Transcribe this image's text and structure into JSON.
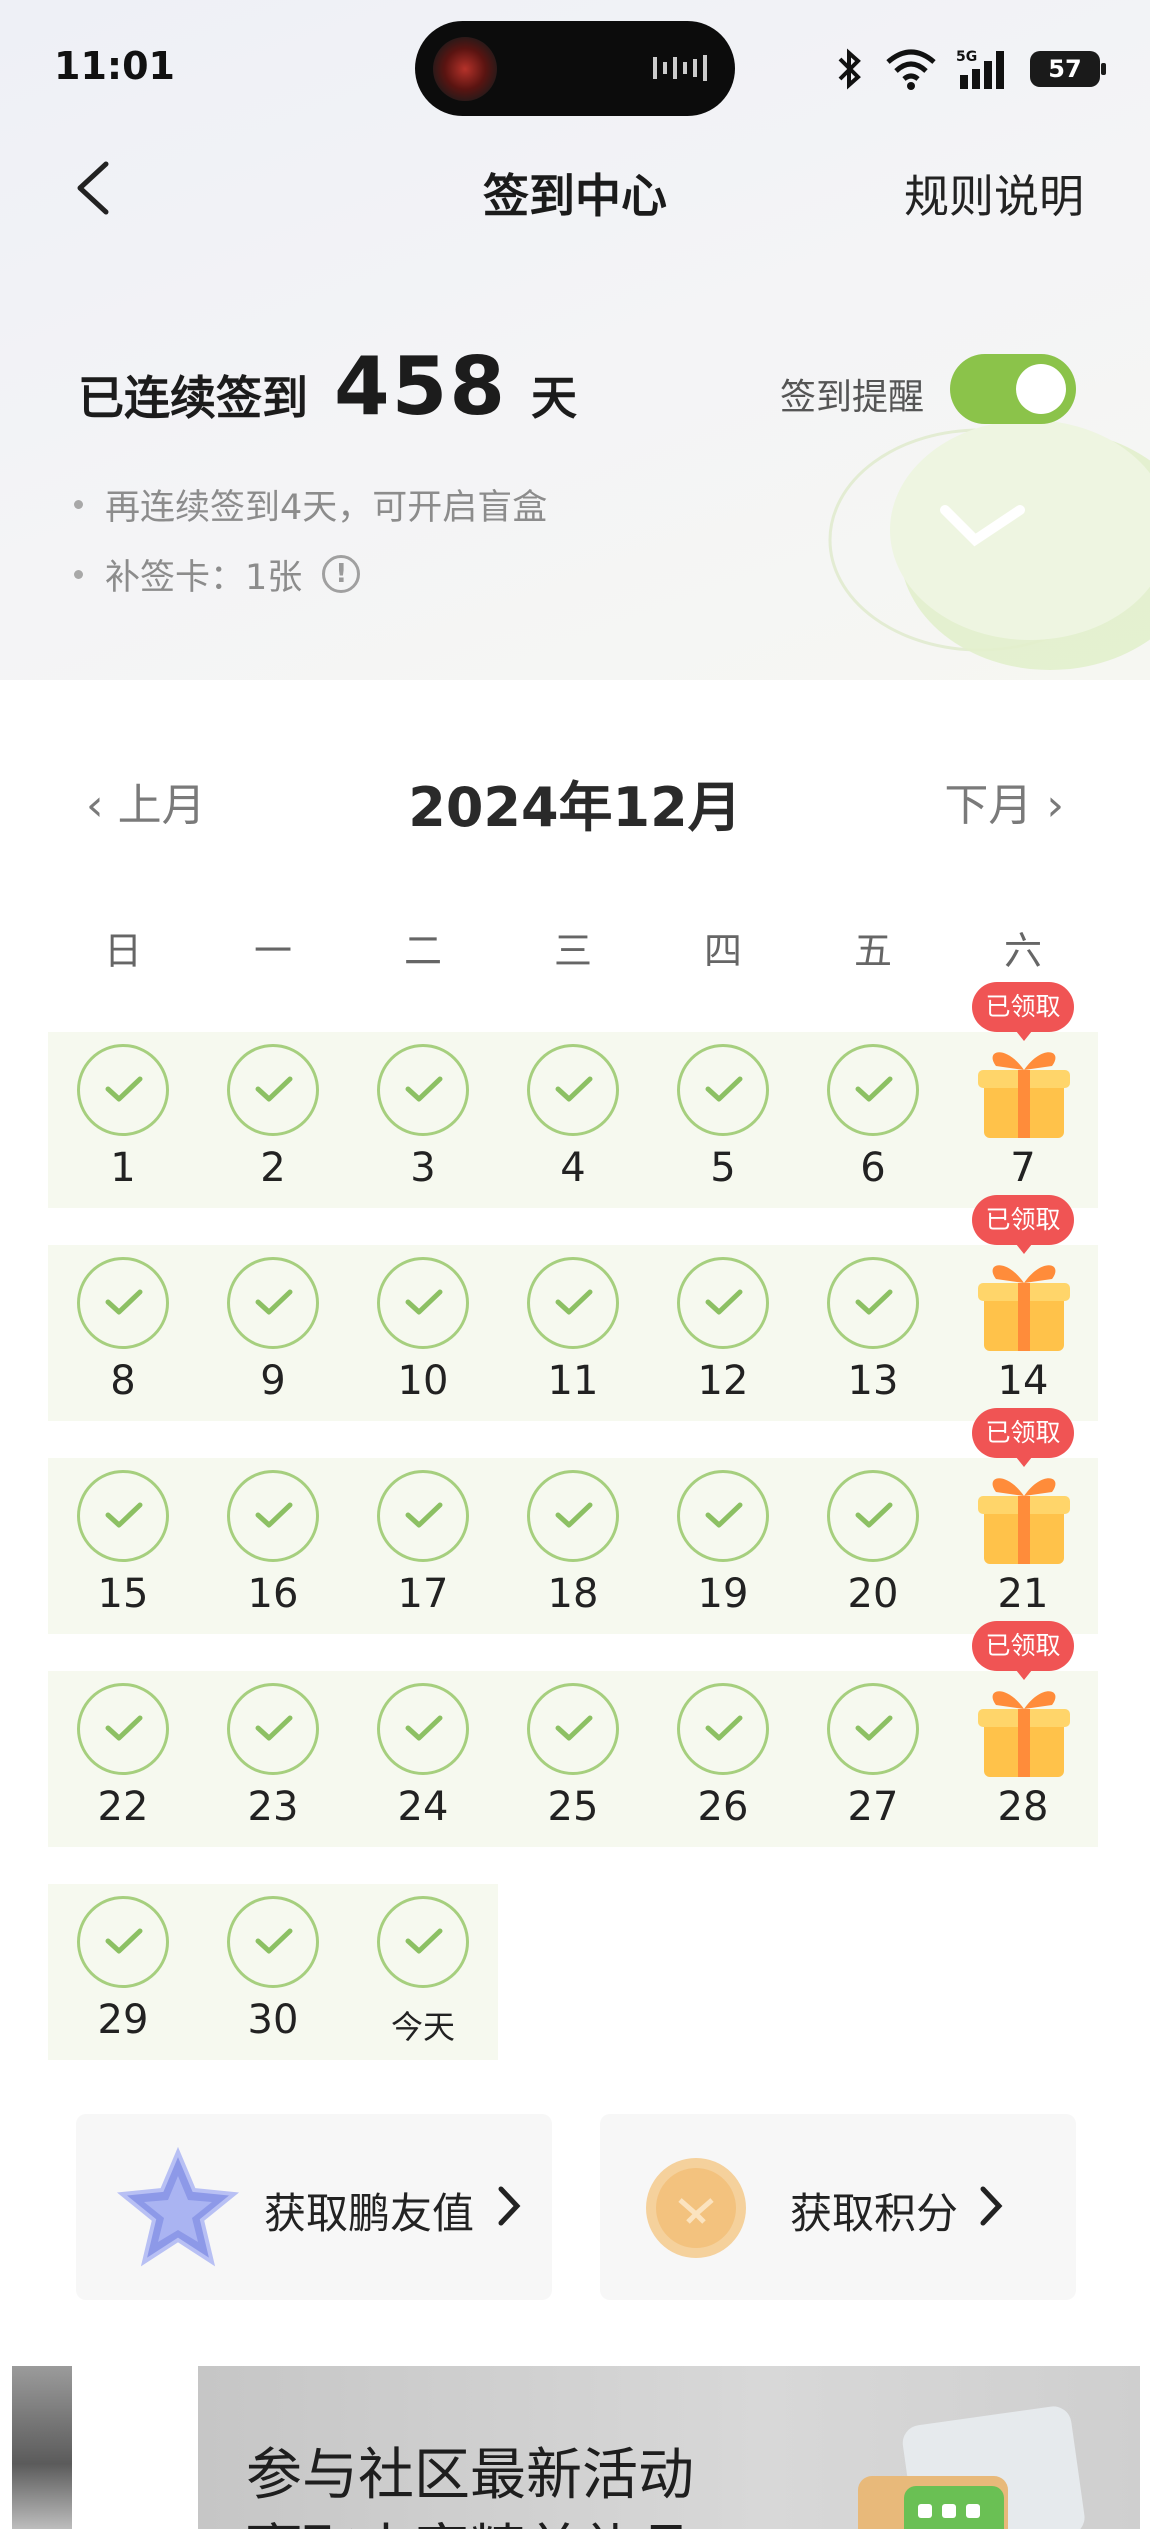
{
  "status_bar": {
    "time": "11:01",
    "signal_label": "5G",
    "battery": "57"
  },
  "nav": {
    "title": "签到中心",
    "rules": "规则说明"
  },
  "streak": {
    "prefix": "已连续签到",
    "days": "458",
    "suffix": "天"
  },
  "reminder": {
    "label": "签到提醒",
    "enabled": true
  },
  "tips": {
    "blind_box": "再连续签到4天，可开启盲盒",
    "makeup_card": "补签卡：1张"
  },
  "calendar": {
    "prev": "上月",
    "title": "2024年12月",
    "next": "下月",
    "weekdays": [
      "日",
      "一",
      "二",
      "三",
      "四",
      "五",
      "六"
    ],
    "claimed_badge": "已领取",
    "weeks": [
      [
        "1",
        "2",
        "3",
        "4",
        "5",
        "6",
        "7"
      ],
      [
        "8",
        "9",
        "10",
        "11",
        "12",
        "13",
        "14"
      ],
      [
        "15",
        "16",
        "17",
        "18",
        "19",
        "20",
        "21"
      ],
      [
        "22",
        "23",
        "24",
        "25",
        "26",
        "27",
        "28"
      ],
      [
        "29",
        "30",
        "今天"
      ]
    ]
  },
  "rewards": {
    "friend_value": "获取鹏友值",
    "points": "获取积分"
  },
  "banner": {
    "title": "参与社区最新活动",
    "subtitle": "赢取丰富精美礼品"
  },
  "colors": {
    "accent_green": "#8bc34a",
    "check_green": "#a6cf7e",
    "badge_red": "#f05454"
  }
}
